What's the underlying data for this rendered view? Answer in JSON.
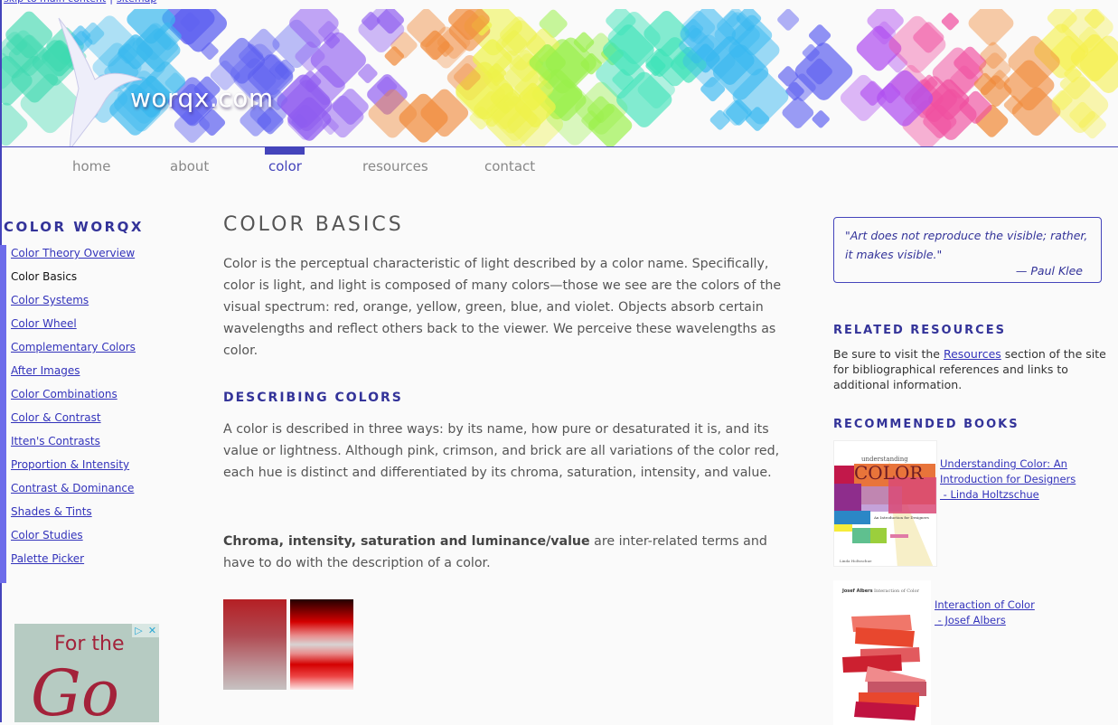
{
  "skip_links": {
    "skip": "skip to main content",
    "sitemap": "sitemap"
  },
  "brand": {
    "name": "worqx.com"
  },
  "colors": {
    "accent": "#4444bb",
    "heading": "#333399",
    "sidebar_bar": "#6d6cea",
    "link": "#3333bb",
    "background": "#fafafa"
  },
  "nav": {
    "items": [
      {
        "label": "home",
        "active": false
      },
      {
        "label": "about",
        "active": false
      },
      {
        "label": "color",
        "active": true
      },
      {
        "label": "resources",
        "active": false
      },
      {
        "label": "contact",
        "active": false
      }
    ]
  },
  "sidebar": {
    "title": "COLOR WORQX",
    "items": [
      {
        "label": "Color Theory Overview",
        "current": false
      },
      {
        "label": "Color Basics",
        "current": true
      },
      {
        "label": "Color Systems",
        "current": false
      },
      {
        "label": "Color Wheel",
        "current": false
      },
      {
        "label": "Complementary Colors",
        "current": false
      },
      {
        "label": "After Images",
        "current": false
      },
      {
        "label": "Color Combinations",
        "current": false
      },
      {
        "label": "Color & Contrast",
        "current": false
      },
      {
        "label": "Itten's Contrasts",
        "current": false
      },
      {
        "label": "Proportion & Intensity",
        "current": false
      },
      {
        "label": "Contrast & Dominance",
        "current": false
      },
      {
        "label": "Shades & Tints",
        "current": false
      },
      {
        "label": "Color Studies",
        "current": false
      },
      {
        "label": "Palette Picker",
        "current": false
      }
    ]
  },
  "ad": {
    "text": "For the",
    "script": "Go",
    "icons": [
      "adchoices-icon",
      "close-icon"
    ]
  },
  "main": {
    "title": "COLOR BASICS",
    "intro": "Color is the perceptual characteristic of light described by a color name. Specifically, color is light, and light is composed of many colors—those we see are the colors of the visual spectrum: red, orange, yellow, green, blue, and violet. Objects absorb certain wavelengths and reflect others back to the viewer. We perceive these wavelengths as color.",
    "section_heading": "DESCRIBING COLORS",
    "describing": "A color is described in three ways: by its name, how pure or desaturated it is, and its value or lightness. Although pink, crimson, and brick are all variations of the color red, each hue is distinct and differentiated by its chroma, saturation, intensity, and value.",
    "terms_bold": "Chroma, intensity, saturation and luminance/value",
    "terms_rest": " are inter-related terms and have to do with the description of a color."
  },
  "right": {
    "quote": "\"Art does not reproduce the visible; rather, it makes visible.\"",
    "quote_author": "— Paul Klee",
    "related_heading": "RELATED RESOURCES",
    "related_pre": "Be sure to visit the ",
    "related_link": "Resources",
    "related_post": " section of the site for bibliographical references and links to additional information.",
    "books_heading": "RECOMMENDED BOOKS",
    "books": [
      {
        "title_line1": "Understanding Color: An",
        "title_line2": "Introduction for Designers",
        "author": " - Linda Holtzschue"
      },
      {
        "title_line1": "Interaction of Color",
        "title_line2": "",
        "author": " - Josef Albers"
      }
    ]
  }
}
